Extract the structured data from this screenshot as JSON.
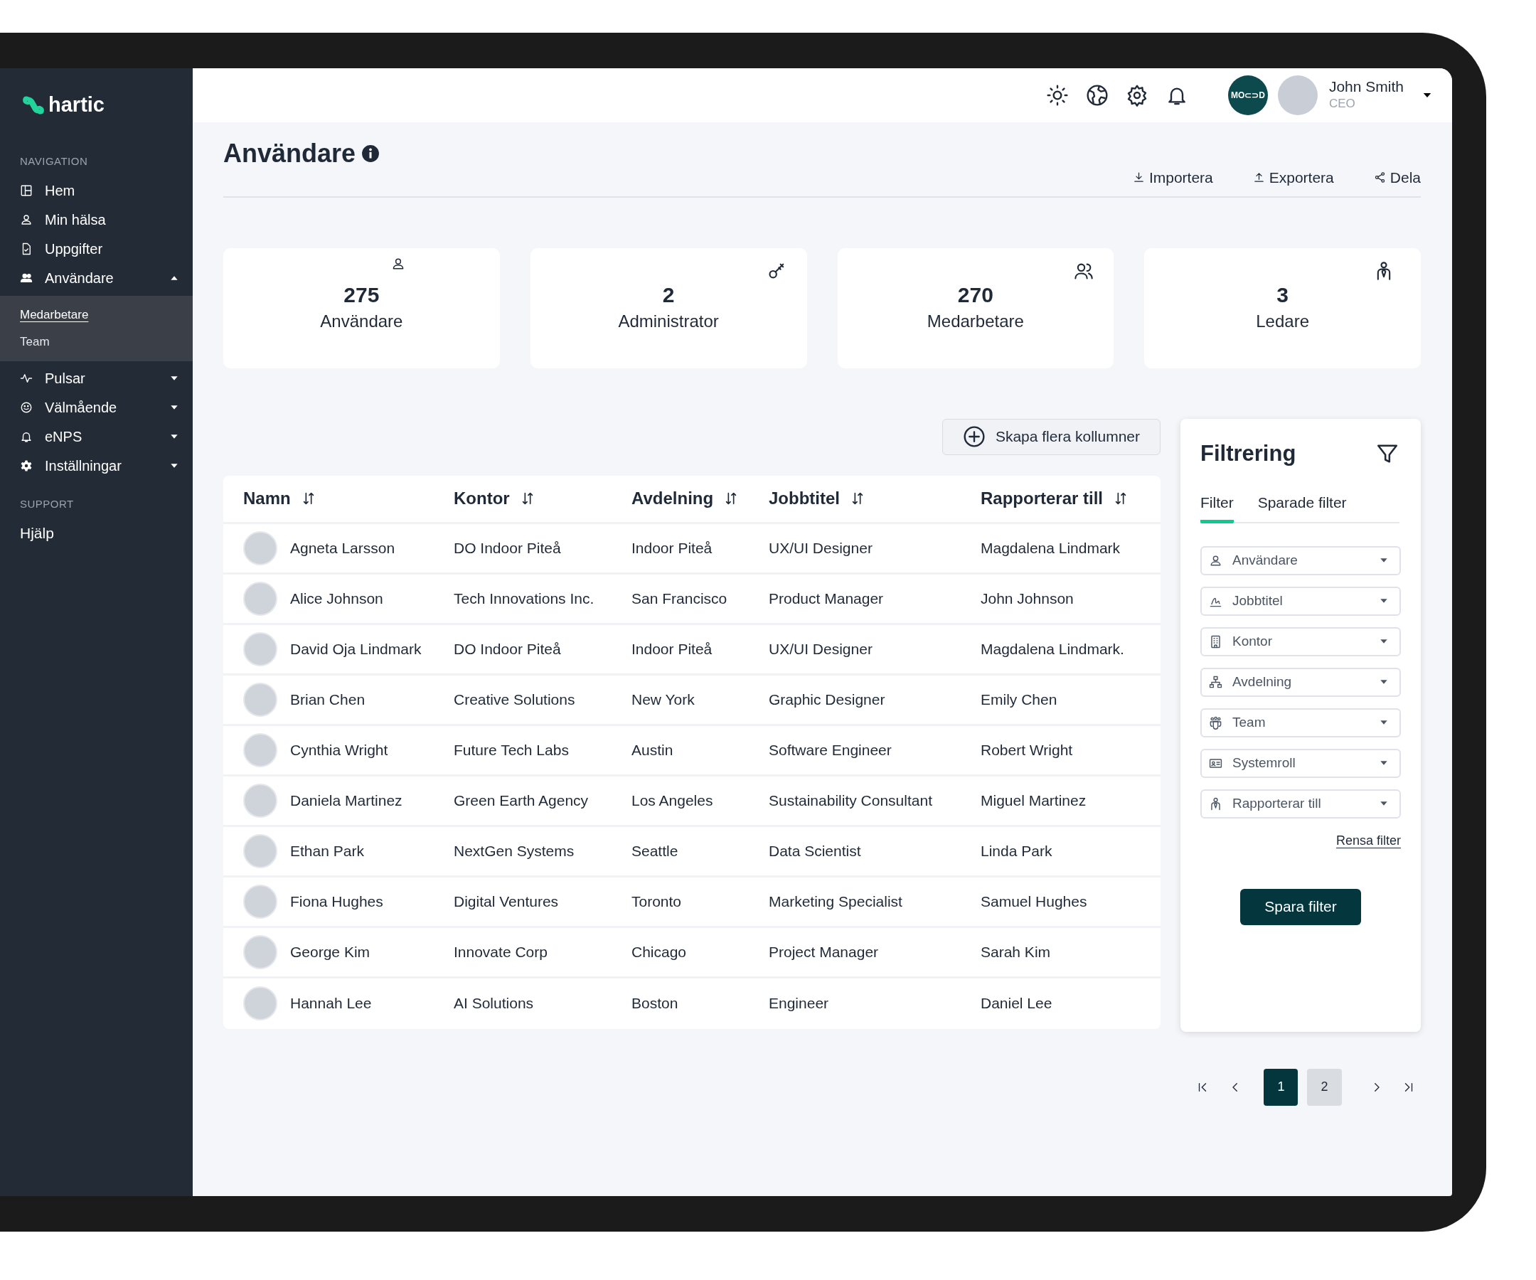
{
  "sidebar": {
    "logo": "hartic",
    "sections": [
      {
        "heading": "NAVIGATION",
        "items": [
          {
            "label": "Hem"
          },
          {
            "label": "Min hälsa"
          },
          {
            "label": "Uppgifter"
          },
          {
            "label": "Användare",
            "expanded": true,
            "children": [
              {
                "label": "Medarbetare",
                "selected": true
              },
              {
                "label": "Team",
                "selected": false
              }
            ]
          },
          {
            "label": "Pulsar",
            "expanded": false
          },
          {
            "label": "Välmående",
            "expanded": false
          },
          {
            "label": "eNPS",
            "expanded": false
          },
          {
            "label": "Inställningar",
            "expanded": false
          }
        ]
      },
      {
        "heading": "SUPPORT",
        "items": [
          {
            "label": "Hjälp"
          }
        ]
      }
    ]
  },
  "topbar": {
    "brand_badge": "MO⊂⊃D",
    "user": {
      "name": "John Smith",
      "role": "CEO"
    }
  },
  "page": {
    "title": "Användare",
    "actions": [
      "Importera",
      "Exportera",
      "Dela"
    ]
  },
  "stats": [
    {
      "value": "275",
      "label": "Användare"
    },
    {
      "value": "2",
      "label": "Administrator"
    },
    {
      "value": "270",
      "label": "Medarbetare"
    },
    {
      "value": "3",
      "label": "Ledare"
    }
  ],
  "add_columns_button": "Skapa flera kollumner",
  "table": {
    "columns": [
      "Namn",
      "Kontor",
      "Avdelning",
      "Jobbtitel",
      "Rapporterar till"
    ],
    "rows": [
      [
        "Agneta Larsson",
        "DO Indoor Piteå",
        "Indoor Piteå",
        "UX/UI Designer",
        "Magdalena Lindmark"
      ],
      [
        "Alice Johnson",
        "Tech Innovations Inc.",
        "San Francisco",
        "Product Manager",
        "John Johnson"
      ],
      [
        "David Oja Lindmark",
        "DO Indoor Piteå",
        "Indoor Piteå",
        "UX/UI Designer",
        "Magdalena Lindmark."
      ],
      [
        "Brian Chen",
        "Creative Solutions",
        "New York",
        "Graphic Designer",
        "Emily Chen"
      ],
      [
        "Cynthia Wright",
        "Future Tech Labs",
        "Austin",
        "Software Engineer",
        "Robert Wright"
      ],
      [
        "Daniela Martinez",
        "Green Earth Agency",
        "Los Angeles",
        "Sustainability Consultant",
        "Miguel Martinez"
      ],
      [
        "Ethan Park",
        "NextGen Systems",
        "Seattle",
        "Data Scientist",
        "Linda Park"
      ],
      [
        "Fiona Hughes",
        "Digital Ventures",
        "Toronto",
        "Marketing Specialist",
        "Samuel Hughes"
      ],
      [
        "George Kim",
        "Innovate Corp",
        "Chicago",
        "Project Manager",
        "Sarah Kim"
      ],
      [
        "Hannah Lee",
        "AI Solutions",
        "Boston",
        "Engineer",
        "Daniel Lee"
      ]
    ]
  },
  "filter_panel": {
    "title": "Filtrering",
    "tabs": [
      {
        "label": "Filter",
        "selected": true
      },
      {
        "label": "Sparade filter",
        "selected": false
      }
    ],
    "dropdowns": [
      {
        "placeholder": "Användare"
      },
      {
        "placeholder": "Jobbtitel"
      },
      {
        "placeholder": "Kontor"
      },
      {
        "placeholder": "Avdelning"
      },
      {
        "placeholder": "Team"
      },
      {
        "placeholder": "Systemroll"
      },
      {
        "placeholder": "Rapporterar till"
      }
    ],
    "clear_link": "Rensa filter",
    "save_button": "Spara filter"
  },
  "pagination": {
    "pages": [
      {
        "label": "1",
        "selected": true
      },
      {
        "label": "2",
        "selected": false
      }
    ]
  }
}
